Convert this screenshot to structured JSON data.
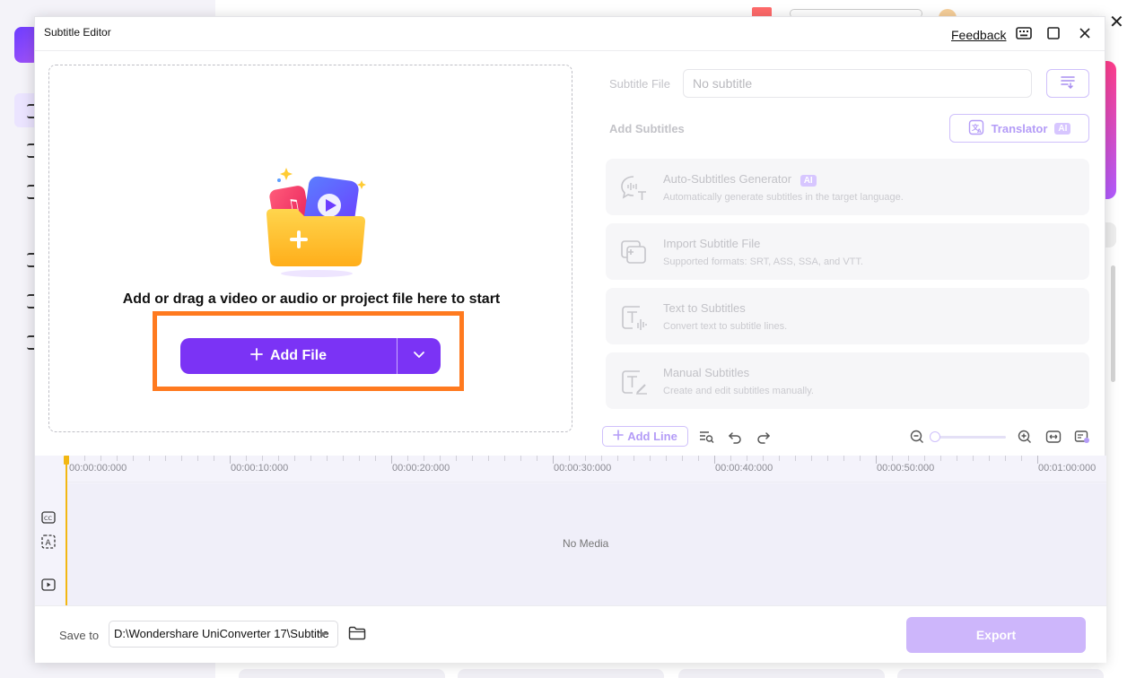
{
  "dialog": {
    "title": "Subtitle Editor",
    "feedback": "Feedback",
    "icons": [
      "keyboard-icon",
      "maximize-icon",
      "close-icon"
    ]
  },
  "dropzone": {
    "instruction": "Add or drag a video or audio or project file here to start",
    "add_file": "Add File"
  },
  "subtitle_file": {
    "label": "Subtitle File",
    "placeholder": "No subtitle"
  },
  "add_subtitles": {
    "label": "Add Subtitles",
    "translator": "Translator",
    "ai_badge": "AI",
    "options": [
      {
        "title": "Auto-Subtitles Generator",
        "desc": "Automatically generate subtitles in the target language.",
        "ai": "AI"
      },
      {
        "title": "Import Subtitle File",
        "desc": "Supported formats: SRT, ASS, SSA, and VTT."
      },
      {
        "title": "Text to Subtitles",
        "desc": "Convert text to subtitle lines."
      },
      {
        "title": "Manual Subtitles",
        "desc": "Create and edit subtitles manually."
      }
    ]
  },
  "timeline": {
    "add_line": "Add Line",
    "zoom_level": 0,
    "times": [
      "00:00:00:000",
      "00:00:10:000",
      "00:00:20:000",
      "00:00:30:000",
      "00:00:40:000",
      "00:00:50:000",
      "00:01:00:000"
    ],
    "empty_text": "No Media"
  },
  "footer": {
    "save_to_label": "Save to",
    "path": "D:\\Wondershare UniConverter 17\\Subtitle",
    "export": "Export"
  },
  "colors": {
    "accent": "#7b33f5",
    "highlight": "#ff7a1f",
    "export_disabled": "#cdb6fb",
    "playhead": "#f2b712"
  }
}
